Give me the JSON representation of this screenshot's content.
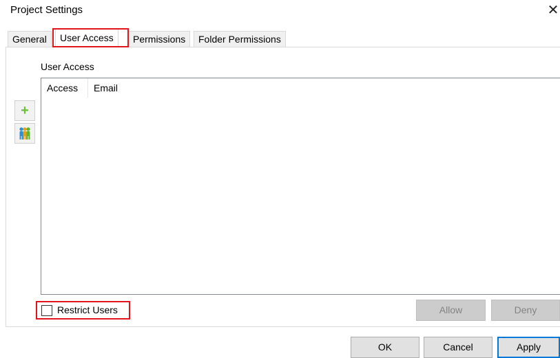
{
  "window": {
    "title": "Project Settings",
    "close_glyph": "✕"
  },
  "tabs": [
    {
      "label": "General",
      "active": false
    },
    {
      "label": "User Access",
      "active": true
    },
    {
      "label": "Permissions",
      "active": false
    },
    {
      "label": "Folder Permissions",
      "active": false
    }
  ],
  "user_access": {
    "group_label": "User Access",
    "columns": [
      "Access",
      "Email"
    ],
    "rows": [],
    "tools": [
      {
        "name": "add-user",
        "icon": "plus-icon",
        "glyph": "+",
        "color": "#6cbf3b"
      },
      {
        "name": "add-group",
        "icon": "users-group-icon"
      }
    ],
    "restrict_users": {
      "label": "Restrict Users",
      "checked": false
    },
    "allow_label": "Allow",
    "deny_label": "Deny"
  },
  "footer": {
    "ok_label": "OK",
    "cancel_label": "Cancel",
    "apply_label": "Apply"
  },
  "colors": {
    "highlight": "#e0141a",
    "primary_border": "#0078d7"
  }
}
